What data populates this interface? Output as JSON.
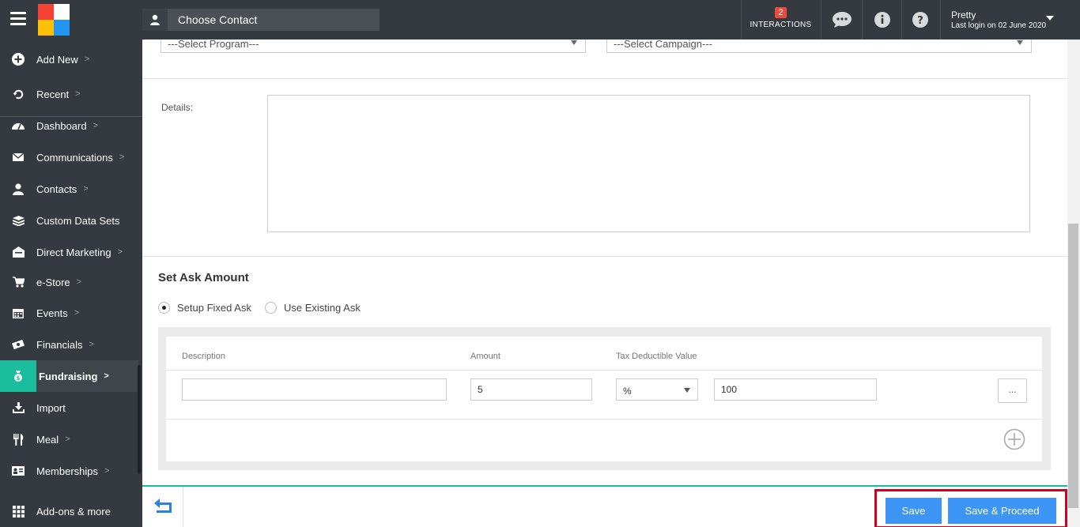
{
  "header": {
    "choose_contact_label": "Choose Contact",
    "interactions_count": "2",
    "interactions_label": "INTERACTIONS",
    "user_name": "Pretty",
    "last_login": "Last login on 02 June 2020",
    "icons": [
      "menu-icon",
      "chat-icon",
      "info-icon",
      "help-icon"
    ]
  },
  "sidebar": {
    "items": [
      {
        "label": "Add New",
        "icon": "plus-circle-icon"
      },
      {
        "label": "Recent",
        "icon": "history-icon"
      },
      {
        "label": "Dashboard",
        "icon": "dashboard-icon"
      },
      {
        "label": "Communications",
        "icon": "envelope-icon"
      },
      {
        "label": "Contacts",
        "icon": "user-icon"
      },
      {
        "label": "Custom Data Sets",
        "icon": "stack-icon"
      },
      {
        "label": "Direct Marketing",
        "icon": "mailbox-icon"
      },
      {
        "label": "e-Store",
        "icon": "cart-icon"
      },
      {
        "label": "Events",
        "icon": "calendar-icon"
      },
      {
        "label": "Financials",
        "icon": "money-icon"
      },
      {
        "label": "Fundraising",
        "icon": "money-bag-icon"
      },
      {
        "label": "Import",
        "icon": "download-icon"
      },
      {
        "label": "Meal",
        "icon": "cutlery-icon"
      },
      {
        "label": "Memberships",
        "icon": "id-card-icon"
      },
      {
        "label": "Add-ons & more",
        "icon": "grid-icon"
      }
    ],
    "active": "Fundraising",
    "active_color": "#1abc9c"
  },
  "form": {
    "program_placeholder": "---Select Program---",
    "campaign_placeholder": "---Select Campaign---",
    "details_label": "Details:",
    "details_value": ""
  },
  "ask": {
    "title": "Set Ask Amount",
    "option_fixed": "Setup Fixed Ask",
    "option_existing": "Use Existing Ask",
    "selected": "Setup Fixed Ask",
    "columns": {
      "description": "Description",
      "amount": "Amount",
      "tax": "Tax Deductible Value"
    },
    "row": {
      "description": "",
      "amount": "5",
      "tax_type": "%",
      "tax_value": "100",
      "more_label": "..."
    }
  },
  "footer": {
    "save_label": "Save",
    "save_proceed_label": "Save & Proceed",
    "button_color": "#3d95f5",
    "highlight_color": "#d0021b"
  }
}
